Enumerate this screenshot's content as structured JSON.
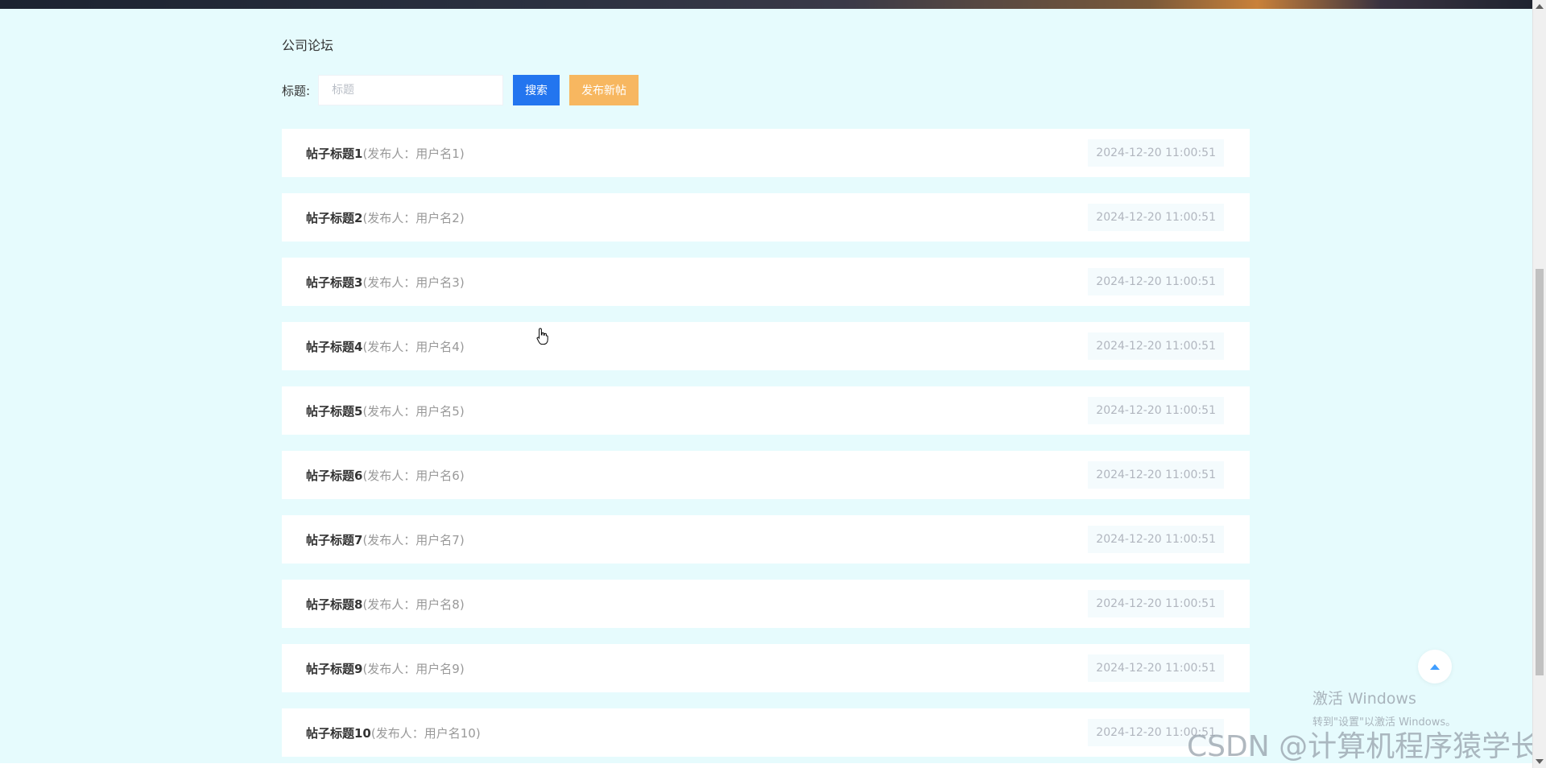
{
  "forum": {
    "title": "公司论坛"
  },
  "search": {
    "label": "标题:",
    "placeholder": "标题",
    "value": "",
    "search_button": "搜索",
    "new_post_button": "发布新帖"
  },
  "posts": [
    {
      "title": "帖子标题1",
      "author": "(发布人：用户名1)",
      "date": "2024-12-20 11:00:51"
    },
    {
      "title": "帖子标题2",
      "author": "(发布人：用户名2)",
      "date": "2024-12-20 11:00:51"
    },
    {
      "title": "帖子标题3",
      "author": "(发布人：用户名3)",
      "date": "2024-12-20 11:00:51"
    },
    {
      "title": "帖子标题4",
      "author": "(发布人：用户名4)",
      "date": "2024-12-20 11:00:51"
    },
    {
      "title": "帖子标题5",
      "author": "(发布人：用户名5)",
      "date": "2024-12-20 11:00:51"
    },
    {
      "title": "帖子标题6",
      "author": "(发布人：用户名6)",
      "date": "2024-12-20 11:00:51"
    },
    {
      "title": "帖子标题7",
      "author": "(发布人：用户名7)",
      "date": "2024-12-20 11:00:51"
    },
    {
      "title": "帖子标题8",
      "author": "(发布人：用户名8)",
      "date": "2024-12-20 11:00:51"
    },
    {
      "title": "帖子标题9",
      "author": "(发布人：用户名9)",
      "date": "2024-12-20 11:00:51"
    },
    {
      "title": "帖子标题10",
      "author": "(发布人：用户名10)",
      "date": "2024-12-20 11:00:51"
    }
  ],
  "overlay": {
    "windows_activate_line1": "激活 Windows",
    "windows_activate_line2": "转到\"设置\"以激活 Windows。",
    "watermark": "CSDN @计算机程序猿学长"
  },
  "icons": {
    "back_to_top": "caret-up-icon",
    "cursor": "hand-pointer-icon"
  },
  "colors": {
    "page_background": "#e6fbfd",
    "search_button": "#2375ef",
    "new_post_button": "#f7b760",
    "back_to_top_arrow": "#409eff"
  }
}
